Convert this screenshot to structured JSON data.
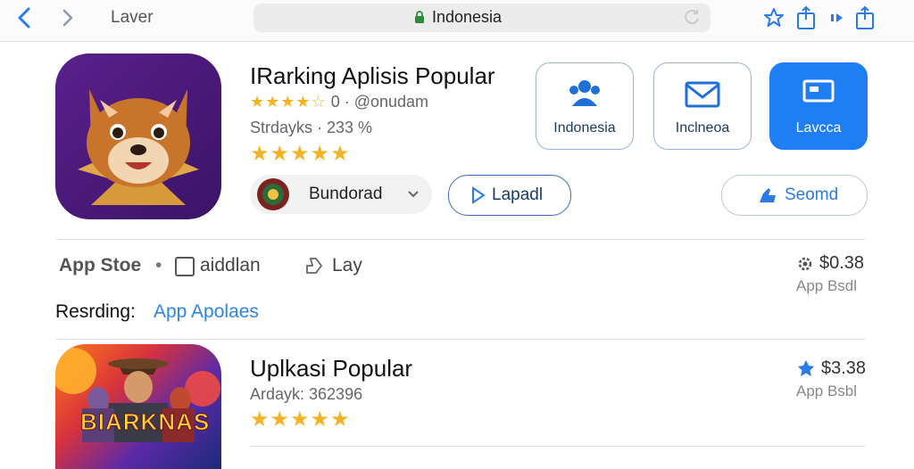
{
  "browser": {
    "tab_title": "Laver",
    "url": "Indonesia"
  },
  "app1": {
    "title": "IRarking Aplisis Popular",
    "rating_line": "0 · @onudam",
    "stars_small": "★★★★☆",
    "stats": "Strdayks · 233 %",
    "stars_large": "★★★★★",
    "developer_label": "Bundorad",
    "download_label": "Lapadl",
    "second_label": "Seomd"
  },
  "categories": [
    {
      "label": "Indonesia",
      "icon": "people-icon",
      "active": false
    },
    {
      "label": "Inclneoa",
      "icon": "mail-icon",
      "active": false
    },
    {
      "label": "Lavcca",
      "icon": "laptop-icon",
      "active": true
    }
  ],
  "store_row": {
    "store": "App Stoe",
    "checkbox_label": "aiddlan",
    "share_label": "Lay",
    "price": "$0.38",
    "price_sub": "App Bsdl"
  },
  "reading_row": {
    "label": "Resrding:",
    "link": "App Apolaes"
  },
  "app2": {
    "title": "Uplkasi Popular",
    "stats": "Ardayk: 362396",
    "stars": "★★★★★",
    "price": "$3.38",
    "price_sub": "App Bsbl",
    "icon_text": "BIARKNAS"
  },
  "colors": {
    "accent": "#1f7ef4",
    "star": "#f4b324",
    "link": "#2a86e8"
  }
}
